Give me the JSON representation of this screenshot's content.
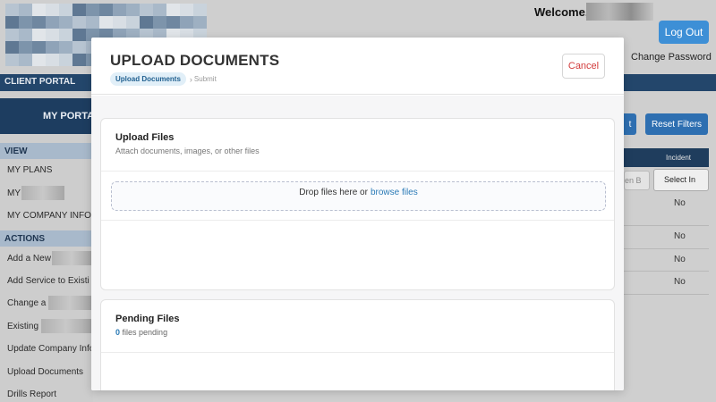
{
  "header": {
    "welcome": "Welcome,",
    "logout_label": "Log Out",
    "change_password": "Change Password"
  },
  "sidebar": {
    "portal_label": "CLIENT PORTAL",
    "my_portal": "MY PORTA",
    "view_heading": "VIEW",
    "view_items": [
      "MY PLANS",
      "MY",
      "MY COMPANY INFO"
    ],
    "actions_heading": "ACTIONS",
    "action_items": [
      "Add a New",
      "Add Service to Existi",
      "Change a",
      "Existing",
      "Update Company Info",
      "Upload Documents",
      "Drills Report"
    ]
  },
  "main": {
    "apply_label": "t",
    "reset_filters": "Reset Filters",
    "incident_header": "Incident",
    "filter_chip": "en B",
    "select_label": "Select In",
    "incident_values": [
      "No",
      "No",
      "No",
      "No"
    ]
  },
  "modal": {
    "title": "UPLOAD DOCUMENTS",
    "cancel_label": "Cancel",
    "breadcrumb_active": "Upload Documents",
    "breadcrumb_next": "Submit",
    "upload_card": {
      "title": "Upload Files",
      "subtitle": "Attach documents, images, or other files",
      "drop_text": "Drop files here or",
      "browse_label": "browse files"
    },
    "pending_card": {
      "title": "Pending Files",
      "count": "0",
      "count_suffix": "files pending"
    }
  },
  "colors": {
    "navy": "#1d3d60",
    "accent_blue": "#3d8fd6",
    "link_blue": "#2a7ab6",
    "cancel_red": "#d23b3b"
  }
}
